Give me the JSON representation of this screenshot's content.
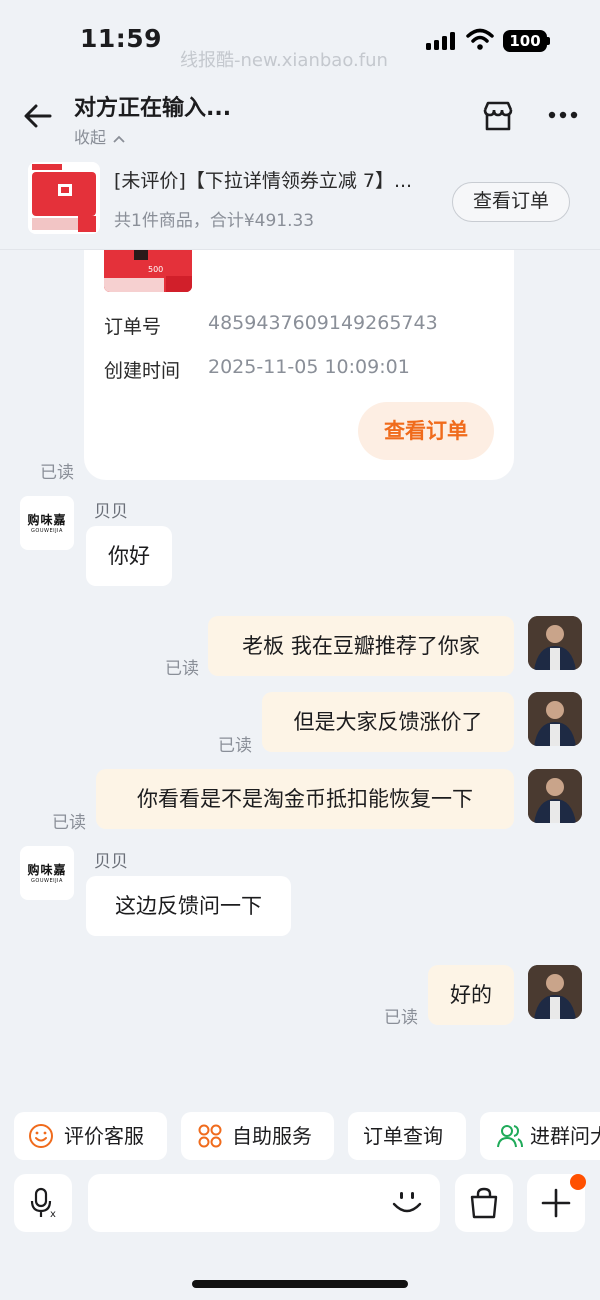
{
  "status": {
    "time": "11:59",
    "watermark": "线报酷-new.xianbao.fun",
    "battery": "100"
  },
  "nav": {
    "title": "对方正在输入...",
    "collapse": "收起"
  },
  "order_bar": {
    "title": "[未评价]【下拉详情领券立减 7】...",
    "summary": "共1件商品，合计¥491.33",
    "button": "查看订单"
  },
  "order_card": {
    "order_no_label": "订单号",
    "order_no": "4859437609149265743",
    "created_label": "创建时间",
    "created": "2025-11-05 10:09:01",
    "button": "查看订单",
    "read": "已读",
    "image_price": "500"
  },
  "shop": {
    "logo_cn": "购味嘉",
    "logo_en": "GOUWEIJIA",
    "name": "贝贝"
  },
  "messages": [
    {
      "from": "shop",
      "text": "你好"
    },
    {
      "from": "me",
      "text": "老板 我在豆瓣推荐了你家",
      "read": "已读"
    },
    {
      "from": "me",
      "text": "但是大家反馈涨价了",
      "read": "已读"
    },
    {
      "from": "me",
      "text": "你看看是不是淘金币抵扣能恢复一下",
      "read": "已读"
    },
    {
      "from": "shop",
      "text": "这边反馈问一下"
    },
    {
      "from": "me",
      "text": "好的",
      "read": "已读"
    }
  ],
  "quick_actions": [
    {
      "label": "评价客服",
      "icon": "smile-icon"
    },
    {
      "label": "自助服务",
      "icon": "grid-dots-icon"
    },
    {
      "label": "订单查询",
      "icon": ""
    },
    {
      "label": "进群问大",
      "icon": "users-icon"
    }
  ],
  "colors": {
    "accent": "#f06b1c",
    "badge": "#ff5000",
    "out_bubble": "#fdf4e6",
    "background": "#eff2f6"
  }
}
